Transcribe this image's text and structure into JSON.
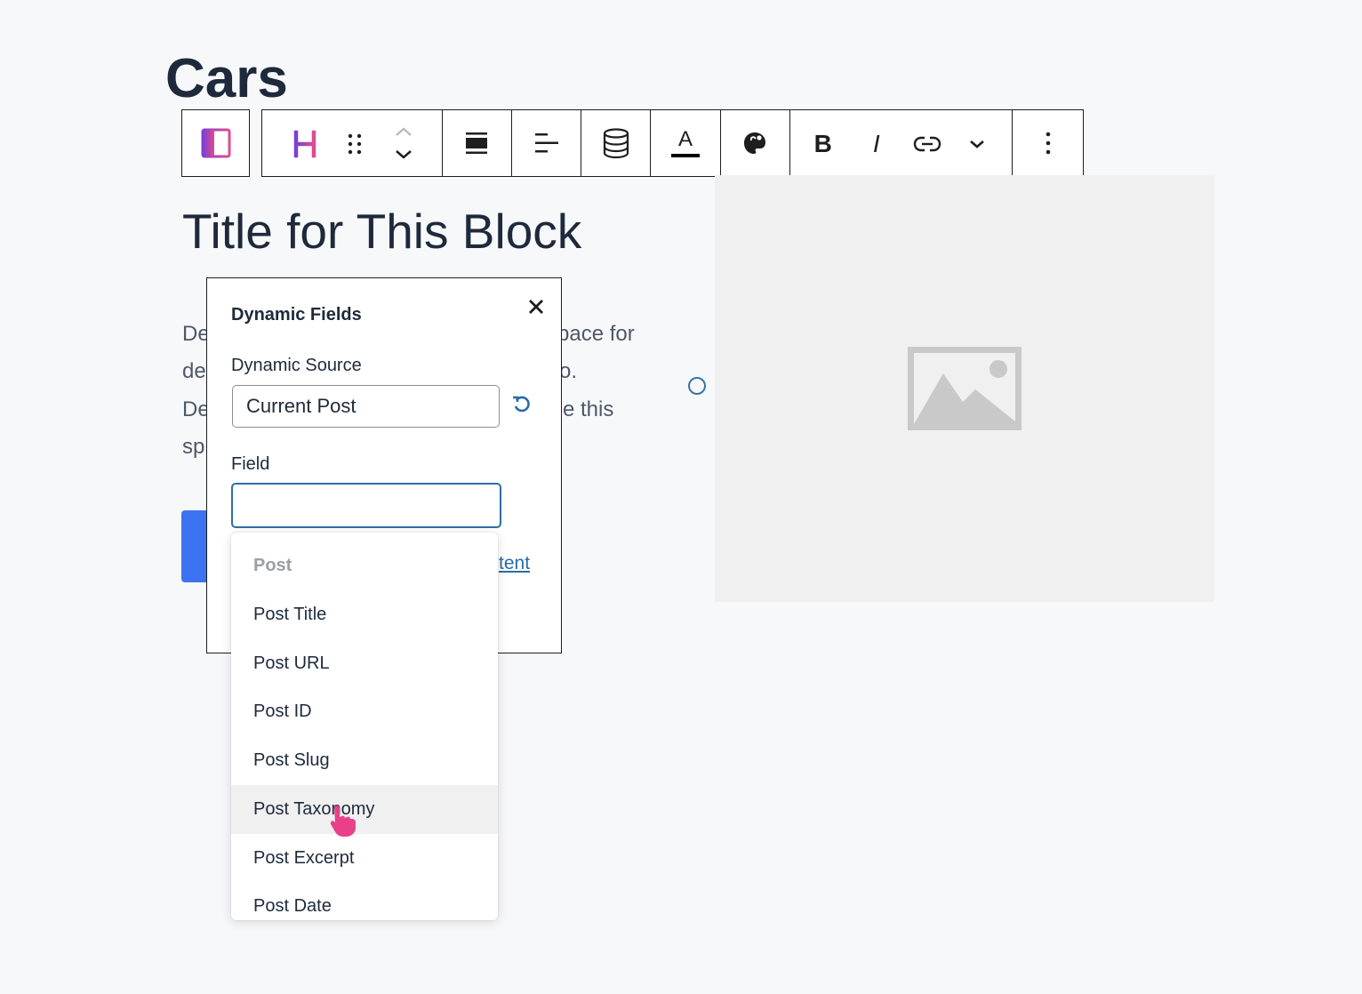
{
  "page": {
    "title": "Cars"
  },
  "block": {
    "title": "Title for This Block",
    "description_fragments": [
      {
        "left": "De",
        "right": "pace for"
      },
      {
        "left": "de",
        "right": "o."
      },
      {
        "left": "De",
        "right": "e this"
      },
      {
        "left": "sp",
        "right": ""
      }
    ]
  },
  "toolbar": {
    "icons": {
      "block_type": "columns-gradient-icon",
      "heading": "heading-h-icon",
      "drag": "drag-handle-icon",
      "move_up": "chevron-up-icon",
      "move_down": "chevron-down-icon",
      "align": "block-align-icon",
      "text_align": "text-align-left-icon",
      "dynamic": "database-icon",
      "text_color": "text-color-icon",
      "style": "paint-palette-icon",
      "bold": "bold-icon",
      "italic": "italic-icon",
      "link": "link-icon",
      "more_format": "chevron-down-icon",
      "options": "more-vertical-icon"
    },
    "bold_label": "B",
    "italic_label": "I",
    "text_color_label": "A",
    "heading_label": "H"
  },
  "dynamic_fields": {
    "title": "Dynamic Fields",
    "source_label": "Dynamic Source",
    "source_value": "Current Post",
    "field_label": "Field",
    "field_value": "",
    "link_fragment": "tent"
  },
  "dropdown": {
    "group_label": "Post",
    "items": [
      {
        "label": "Post Title"
      },
      {
        "label": "Post URL"
      },
      {
        "label": "Post ID"
      },
      {
        "label": "Post Slug"
      },
      {
        "label": "Post Taxonomy",
        "hovered": true
      },
      {
        "label": "Post Excerpt"
      },
      {
        "label": "Post Date"
      }
    ]
  },
  "colors": {
    "accent_blue": "#3d72f0",
    "focus_blue": "#2e6ea6",
    "heading_gradient_start": "#7b3fd8",
    "heading_gradient_end": "#e24b8c",
    "cursor_pink": "#e8418a"
  }
}
